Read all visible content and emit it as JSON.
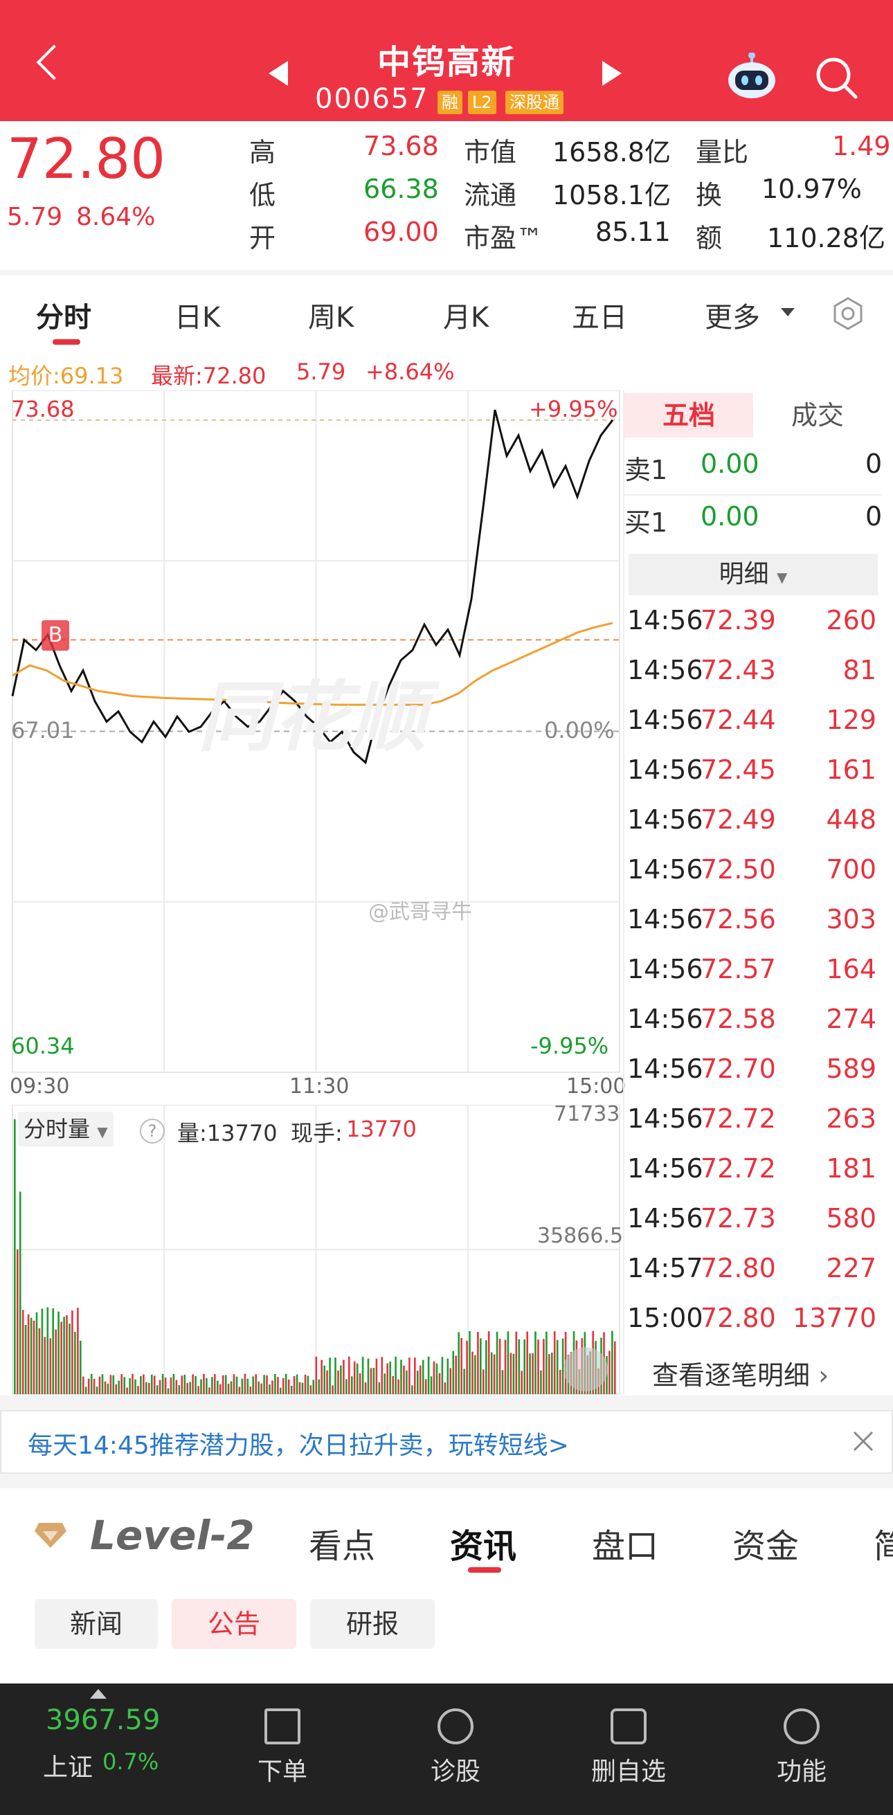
{
  "header": {
    "title": "中钨高新",
    "code": "000657",
    "tags": [
      "融",
      "L2",
      "深股通"
    ]
  },
  "quote": {
    "price": "72.80",
    "change": "5.79",
    "change_pct": "8.64%",
    "labels": {
      "high": "高",
      "low": "低",
      "open": "开",
      "mcap": "市值",
      "float": "流通",
      "pe": "市盈™",
      "vol_ratio": "量比",
      "turnover": "换",
      "amount": "额"
    },
    "high": "73.68",
    "low": "66.38",
    "open": "69.00",
    "mcap": "1658.8亿",
    "float": "1058.1亿",
    "pe": "85.11",
    "vol_ratio": "1.49",
    "turnover": "10.97%",
    "amount": "110.28亿"
  },
  "tabs": [
    "分时",
    "日K",
    "周K",
    "月K",
    "五日",
    "更多"
  ],
  "summary": {
    "avg": "均价:69.13",
    "latest": "最新:72.80",
    "chg": "5.79",
    "pct": "+8.64%"
  },
  "chart": {
    "y_top": "73.68",
    "y_mid": "67.01",
    "y_bot": "60.34",
    "pct_top": "+9.95%",
    "pct_mid": "0.00%",
    "pct_bot": "-9.95%",
    "x_labels": [
      "09:30",
      "11:30",
      "15:00"
    ],
    "buy_mark": "B",
    "watermark": "同花顺",
    "weibo": "@武哥寻牛",
    "vol_selector": "分时量",
    "vol_label": "量:13770",
    "hand_label": "现手:",
    "hand_value": "13770",
    "vol_top": "71733",
    "vol_mid": "35866.5"
  },
  "chart_data": {
    "type": "line",
    "x_range": [
      "09:30",
      "15:00"
    ],
    "ylim": [
      60.34,
      73.68
    ],
    "series": [
      {
        "name": "最新",
        "values": [
          67.7,
          68.8,
          68.6,
          68.9,
          68.3,
          67.8,
          68.2,
          67.6,
          67.2,
          67.4,
          67.0,
          66.8,
          67.2,
          66.9,
          67.3,
          67.0,
          67.1,
          67.4,
          67.6,
          67.3,
          67.1,
          67.2,
          67.5,
          67.8,
          67.6,
          67.3,
          67.1,
          66.8,
          67.0,
          66.6,
          66.4,
          67.3,
          67.9,
          68.4,
          68.6,
          69.1,
          68.7,
          69.0,
          68.5,
          69.6,
          71.4,
          73.3,
          72.4,
          72.8,
          72.1,
          72.5,
          71.8,
          72.2,
          71.6,
          72.3,
          72.8,
          73.1
        ]
      },
      {
        "name": "均价",
        "values": [
          68.1,
          68.3,
          68.2,
          68.0,
          67.9,
          67.8,
          67.75,
          67.7,
          67.68,
          67.66,
          67.65,
          67.64,
          67.63,
          67.62,
          67.6,
          67.58,
          67.56,
          67.55,
          67.54,
          67.53,
          67.53,
          67.53,
          67.53,
          67.53,
          67.53,
          67.6,
          67.75,
          68.0,
          68.2,
          68.35,
          68.5,
          68.65,
          68.8,
          68.95,
          69.05,
          69.13
        ]
      }
    ],
    "volume_max": 71733
  },
  "orderbook": {
    "tabs": [
      "五档",
      "成交"
    ],
    "sell1": {
      "label": "卖1",
      "price": "0.00",
      "vol": "0"
    },
    "buy1": {
      "label": "买1",
      "price": "0.00",
      "vol": "0"
    },
    "detail_label": "明细",
    "ticks": [
      {
        "t": "14:56",
        "p": "72.39",
        "v": "260"
      },
      {
        "t": "14:56",
        "p": "72.43",
        "v": "81"
      },
      {
        "t": "14:56",
        "p": "72.44",
        "v": "129"
      },
      {
        "t": "14:56",
        "p": "72.45",
        "v": "161"
      },
      {
        "t": "14:56",
        "p": "72.49",
        "v": "448"
      },
      {
        "t": "14:56",
        "p": "72.50",
        "v": "700"
      },
      {
        "t": "14:56",
        "p": "72.56",
        "v": "303"
      },
      {
        "t": "14:56",
        "p": "72.57",
        "v": "164"
      },
      {
        "t": "14:56",
        "p": "72.58",
        "v": "274"
      },
      {
        "t": "14:56",
        "p": "72.70",
        "v": "589"
      },
      {
        "t": "14:56",
        "p": "72.72",
        "v": "263"
      },
      {
        "t": "14:56",
        "p": "72.72",
        "v": "181"
      },
      {
        "t": "14:56",
        "p": "72.73",
        "v": "580"
      },
      {
        "t": "14:57",
        "p": "72.80",
        "v": "227"
      },
      {
        "t": "15:00",
        "p": "72.80",
        "v": "13770"
      }
    ],
    "more": "查看逐笔明细"
  },
  "banner": {
    "text": "每天14:45推荐潜力股，次日拉升卖，玩转短线>"
  },
  "news": {
    "level2": "Level-2",
    "tabs": [
      "看点",
      "资讯",
      "盘口",
      "资金",
      "简"
    ],
    "chips": [
      "新闻",
      "公告",
      "研报"
    ]
  },
  "footer": {
    "index_value": "3967.59",
    "index_name": "上证",
    "index_pct": "0.7%",
    "items": [
      "下单",
      "诊股",
      "删自选",
      "功能"
    ]
  },
  "colors": {
    "up": "#e8313c",
    "down": "#1a9e2e",
    "brand": "#ee3344",
    "avg_line": "#f0a030"
  }
}
